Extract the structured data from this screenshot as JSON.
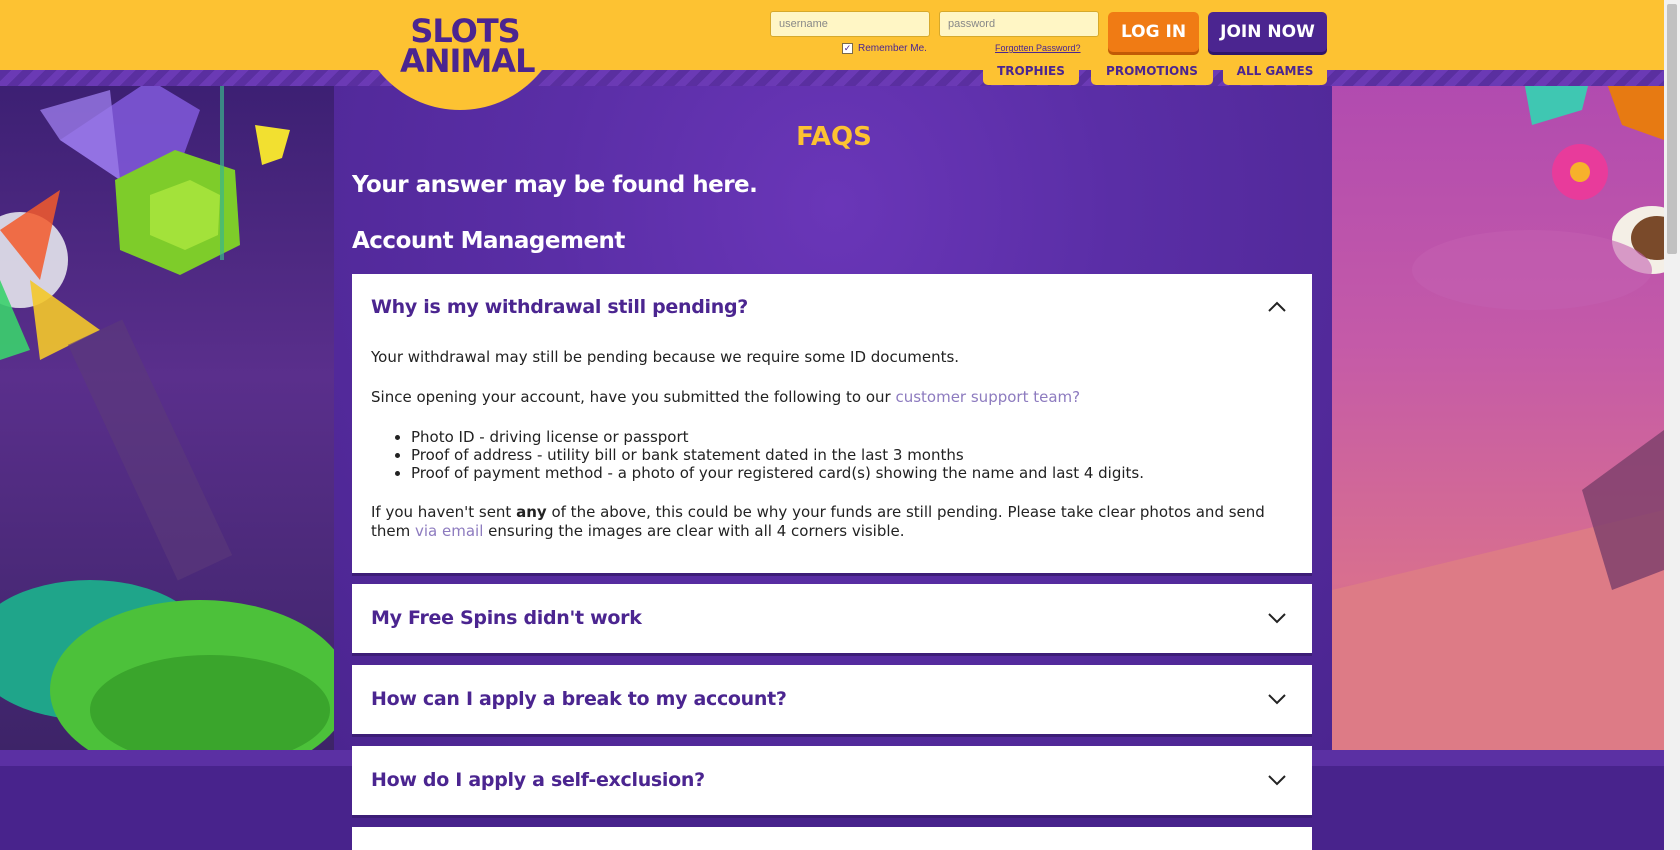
{
  "header": {
    "logo_line1": "SLOTS",
    "logo_line2": "ANIMAL",
    "username_placeholder": "username",
    "password_placeholder": "password",
    "remember_label": "Remember Me.",
    "forgot_label": "Forgotten Password?",
    "login_label": "LOG IN",
    "join_label": "JOIN NOW"
  },
  "nav": {
    "items": [
      {
        "label": "TROPHIES"
      },
      {
        "label": "PROMOTIONS"
      },
      {
        "label": "ALL GAMES"
      }
    ]
  },
  "main": {
    "title": "FAQS",
    "subtitle": "Your answer may be found here.",
    "section": "Account Management"
  },
  "faqs": [
    {
      "question": "Why is my withdrawal still pending?",
      "expanded": true,
      "answer": {
        "p1": "Your withdrawal may still be pending because we require some ID documents.",
        "p2_prefix": "Since opening your account, have you submitted the following to our ",
        "p2_link": "customer support team?",
        "list": [
          "Photo ID - driving license or passport",
          "Proof of address - utility bill or bank statement dated in the last 3 months",
          "Proof of payment method - a photo of your registered card(s) showing the name and last 4 digits."
        ],
        "p3_prefix": "If you haven't sent ",
        "p3_bold": "any",
        "p3_mid": " of the above, this could be why your funds are still pending. Please take clear photos and send them ",
        "p3_link": "via email",
        "p3_suffix": " ensuring the images are clear with all 4 corners visible."
      }
    },
    {
      "question": "My Free Spins didn't work",
      "expanded": false
    },
    {
      "question": "How can I apply a break to my account?",
      "expanded": false
    },
    {
      "question": "How do I apply a self-exclusion?",
      "expanded": false
    }
  ],
  "colors": {
    "brand_yellow": "#fdc232",
    "brand_purple": "#4b2590",
    "login_orange": "#f07b14",
    "link": "#8d7bbf"
  }
}
